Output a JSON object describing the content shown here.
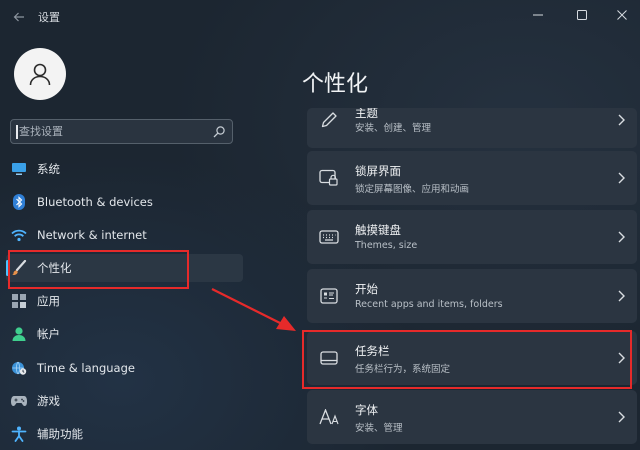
{
  "window": {
    "title": "设置",
    "controls": [
      "minimize",
      "maximize",
      "close"
    ]
  },
  "search": {
    "value": "",
    "placeholder": "查找设置"
  },
  "sidebar": {
    "items": [
      {
        "label": "系统",
        "icon": "system-display-icon",
        "active": false
      },
      {
        "label": "Bluetooth & devices",
        "icon": "bluetooth-icon",
        "active": false
      },
      {
        "label": "Network & internet",
        "icon": "wifi-icon",
        "active": false
      },
      {
        "label": "个性化",
        "icon": "brush-icon",
        "active": true
      },
      {
        "label": "应用",
        "icon": "apps-grid-icon",
        "active": false
      },
      {
        "label": "帐户",
        "icon": "account-icon",
        "active": false
      },
      {
        "label": "Time & language",
        "icon": "globe-clock-icon",
        "active": false
      },
      {
        "label": "游戏",
        "icon": "gamepad-icon",
        "active": false
      },
      {
        "label": "辅助功能",
        "icon": "accessibility-icon",
        "active": false
      }
    ]
  },
  "main": {
    "page_title": "个性化",
    "cards": [
      {
        "title": "主题",
        "subtitle": "安装、创建、管理",
        "icon": "pen-icon"
      },
      {
        "title": "锁屏界面",
        "subtitle": "锁定屏幕图像、应用和动画",
        "icon": "lock-screen-icon"
      },
      {
        "title": "触摸键盘",
        "subtitle": "Themes, size",
        "icon": "keyboard-icon"
      },
      {
        "title": "开始",
        "subtitle": "Recent apps and items, folders",
        "icon": "start-menu-icon"
      },
      {
        "title": "任务栏",
        "subtitle": "任务栏行为，系统固定",
        "icon": "taskbar-icon"
      },
      {
        "title": "字体",
        "subtitle": "安装、管理",
        "icon": "font-icon"
      }
    ]
  },
  "colors": {
    "accent": "#4cc2ff",
    "highlight_box": "#e62a2a",
    "card_bg": "#2b3541"
  }
}
